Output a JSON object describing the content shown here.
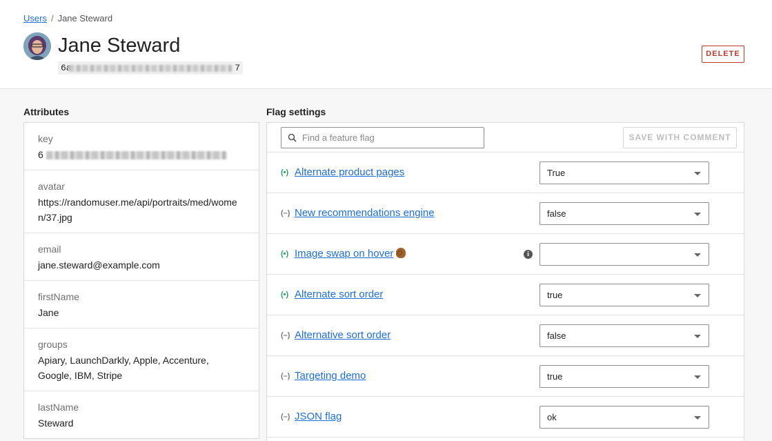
{
  "breadcrumb": {
    "parent": "Users",
    "separator": "/",
    "current": "Jane Steward"
  },
  "user": {
    "name": "Jane Steward",
    "id_prefix": "6a",
    "id_suffix": "7"
  },
  "header": {
    "delete_label": "DELETE"
  },
  "attributes": {
    "title": "Attributes",
    "items": [
      {
        "key": "key",
        "value": "6"
      },
      {
        "key": "avatar",
        "value": "https://randomuser.me/api/portraits/med/women/37.jpg"
      },
      {
        "key": "email",
        "value": "jane.steward@example.com"
      },
      {
        "key": "firstName",
        "value": "Jane"
      },
      {
        "key": "groups",
        "value": "Apiary, LaunchDarkly, Apple, Accenture, Google, IBM, Stripe"
      },
      {
        "key": "lastName",
        "value": "Steward"
      }
    ]
  },
  "flags": {
    "title": "Flag settings",
    "search_placeholder": "Find a feature flag",
    "save_label": "SAVE WITH COMMENT",
    "status_on_glyph": "(•)",
    "status_off_glyph": "(–)",
    "items": [
      {
        "name": "Alternate product pages",
        "status": "on",
        "value": "True"
      },
      {
        "name": "New recommendations engine",
        "status": "off",
        "value": "false"
      },
      {
        "name": "Image swap on hover",
        "status": "on",
        "value": "",
        "has_info": true,
        "emoji": "ok-hand-emoji"
      },
      {
        "name": "Alternate sort order",
        "status": "on",
        "value": "true"
      },
      {
        "name": "Alternative sort order",
        "status": "off",
        "value": "false"
      },
      {
        "name": "Targeting demo",
        "status": "off",
        "value": "true"
      },
      {
        "name": "JSON flag",
        "status": "off",
        "value": "ok"
      }
    ]
  },
  "colors": {
    "link": "#1e6fd9",
    "danger": "#c0392b",
    "on": "#2a9d6a"
  }
}
